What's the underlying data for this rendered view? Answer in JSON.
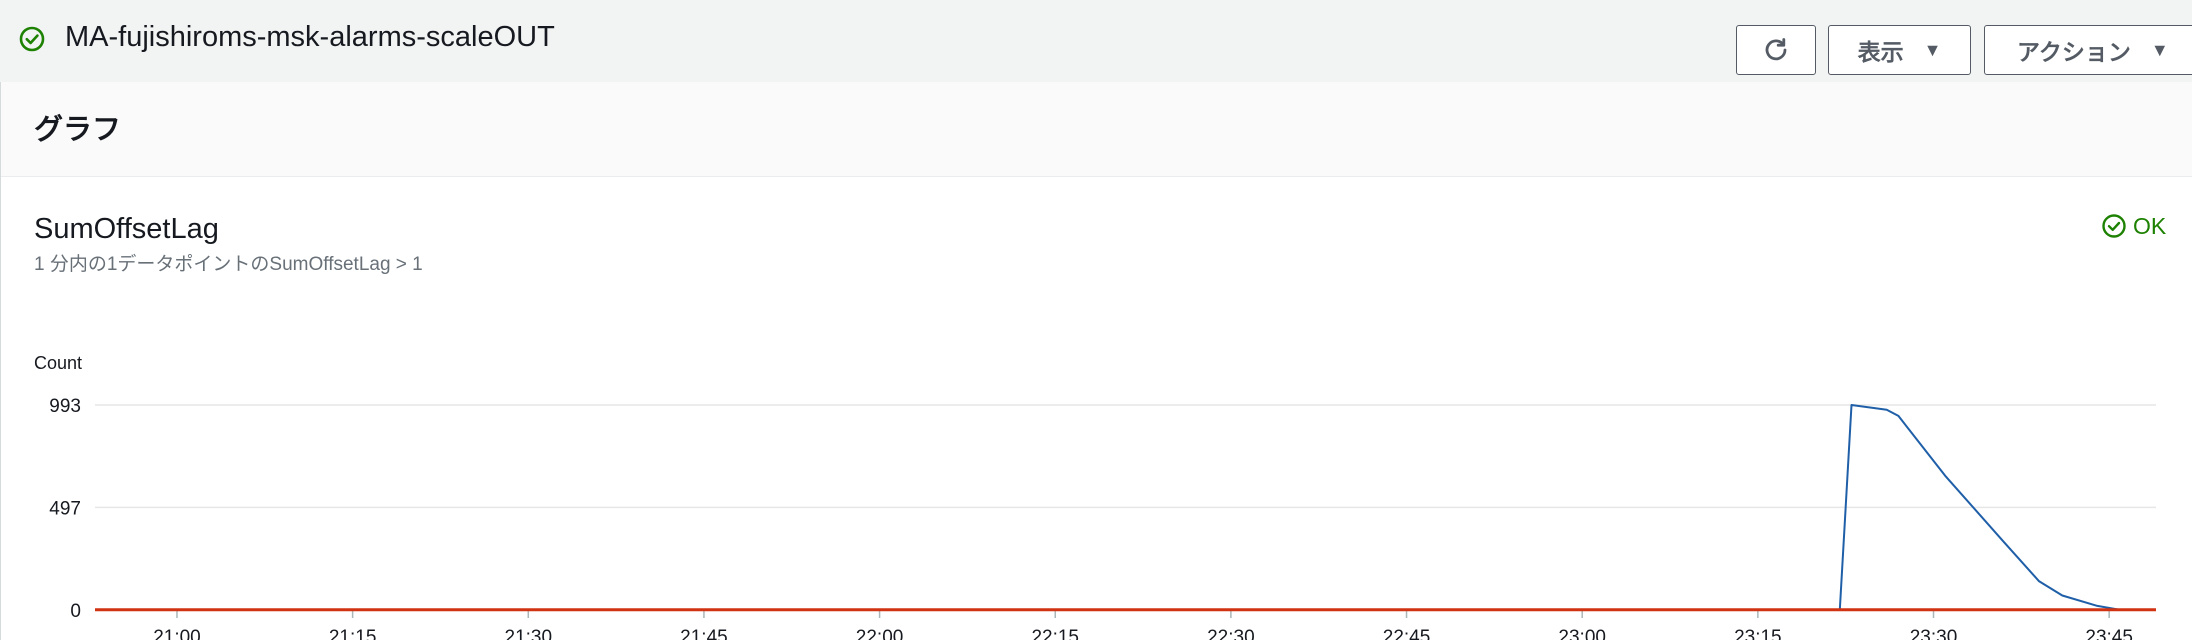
{
  "header": {
    "title": "MA-fujishiroms-msk-alarms-scaleOUT",
    "status_icon": "check-circle-icon",
    "refresh_icon": "refresh-icon",
    "view_label": "表示",
    "actions_label": "アクション"
  },
  "panel": {
    "title": "グラフ"
  },
  "metric": {
    "name": "SumOffsetLag",
    "description": "1 分内の1データポイントのSumOffsetLag > 1",
    "state": "OK"
  },
  "colors": {
    "ok_green": "#1d8102",
    "series_blue": "#1f5fa8",
    "threshold_red": "#d13212",
    "grid": "#e6e6e6"
  },
  "chart_data": {
    "type": "line",
    "ylabel": "Count",
    "ylim": [
      0,
      993
    ],
    "yticks": [
      "0",
      "497",
      "993"
    ],
    "xticks": [
      "21:00",
      "21:15",
      "21:30",
      "21:45",
      "22:00",
      "22:15",
      "22:30",
      "22:45",
      "23:00",
      "23:15",
      "23:30",
      "23:45"
    ],
    "xlim": [
      "20:53",
      "23:49"
    ],
    "series": [
      {
        "role": "metric",
        "x": [
          "20:53",
          "23:22",
          "23:23",
          "23:26",
          "23:27",
          "23:31",
          "23:36",
          "23:39",
          "23:41",
          "23:44",
          "23:46",
          "23:49"
        ],
        "y": [
          0,
          0,
          993,
          970,
          940,
          650,
          330,
          140,
          70,
          20,
          0,
          0
        ]
      },
      {
        "role": "threshold",
        "x": [
          "20:53",
          "23:49"
        ],
        "y": [
          1,
          1
        ]
      }
    ]
  }
}
